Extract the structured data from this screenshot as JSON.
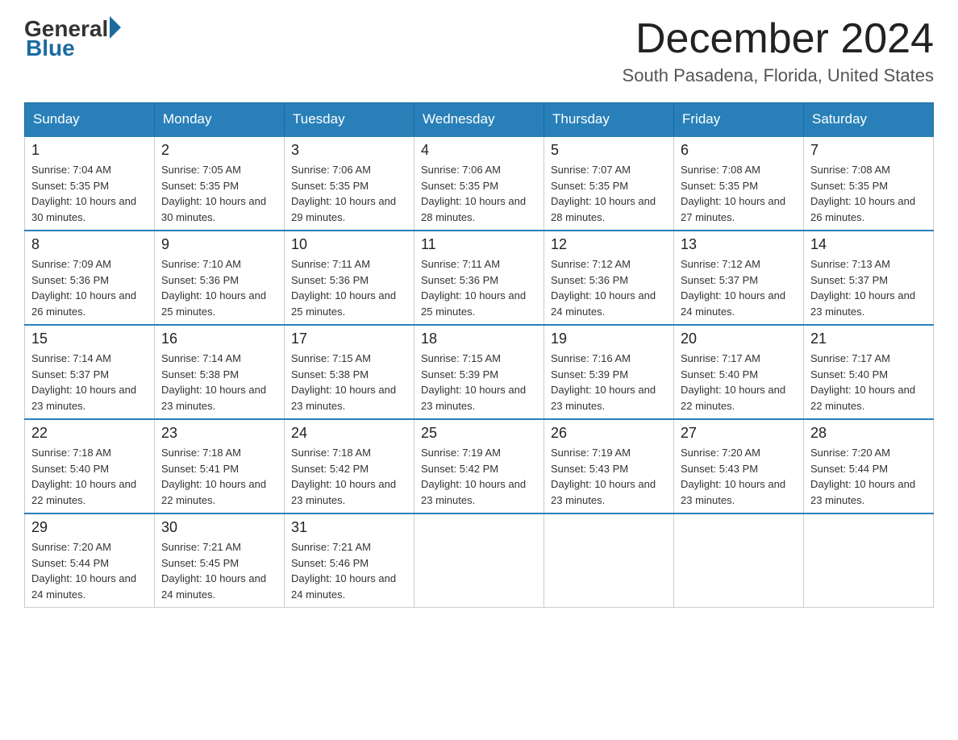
{
  "header": {
    "logo": {
      "general": "General",
      "blue": "Blue"
    },
    "title": "December 2024",
    "location": "South Pasadena, Florida, United States"
  },
  "weekdays": [
    "Sunday",
    "Monday",
    "Tuesday",
    "Wednesday",
    "Thursday",
    "Friday",
    "Saturday"
  ],
  "weeks": [
    [
      {
        "day": "1",
        "sunrise": "7:04 AM",
        "sunset": "5:35 PM",
        "daylight": "10 hours and 30 minutes."
      },
      {
        "day": "2",
        "sunrise": "7:05 AM",
        "sunset": "5:35 PM",
        "daylight": "10 hours and 30 minutes."
      },
      {
        "day": "3",
        "sunrise": "7:06 AM",
        "sunset": "5:35 PM",
        "daylight": "10 hours and 29 minutes."
      },
      {
        "day": "4",
        "sunrise": "7:06 AM",
        "sunset": "5:35 PM",
        "daylight": "10 hours and 28 minutes."
      },
      {
        "day": "5",
        "sunrise": "7:07 AM",
        "sunset": "5:35 PM",
        "daylight": "10 hours and 28 minutes."
      },
      {
        "day": "6",
        "sunrise": "7:08 AM",
        "sunset": "5:35 PM",
        "daylight": "10 hours and 27 minutes."
      },
      {
        "day": "7",
        "sunrise": "7:08 AM",
        "sunset": "5:35 PM",
        "daylight": "10 hours and 26 minutes."
      }
    ],
    [
      {
        "day": "8",
        "sunrise": "7:09 AM",
        "sunset": "5:36 PM",
        "daylight": "10 hours and 26 minutes."
      },
      {
        "day": "9",
        "sunrise": "7:10 AM",
        "sunset": "5:36 PM",
        "daylight": "10 hours and 25 minutes."
      },
      {
        "day": "10",
        "sunrise": "7:11 AM",
        "sunset": "5:36 PM",
        "daylight": "10 hours and 25 minutes."
      },
      {
        "day": "11",
        "sunrise": "7:11 AM",
        "sunset": "5:36 PM",
        "daylight": "10 hours and 25 minutes."
      },
      {
        "day": "12",
        "sunrise": "7:12 AM",
        "sunset": "5:36 PM",
        "daylight": "10 hours and 24 minutes."
      },
      {
        "day": "13",
        "sunrise": "7:12 AM",
        "sunset": "5:37 PM",
        "daylight": "10 hours and 24 minutes."
      },
      {
        "day": "14",
        "sunrise": "7:13 AM",
        "sunset": "5:37 PM",
        "daylight": "10 hours and 23 minutes."
      }
    ],
    [
      {
        "day": "15",
        "sunrise": "7:14 AM",
        "sunset": "5:37 PM",
        "daylight": "10 hours and 23 minutes."
      },
      {
        "day": "16",
        "sunrise": "7:14 AM",
        "sunset": "5:38 PM",
        "daylight": "10 hours and 23 minutes."
      },
      {
        "day": "17",
        "sunrise": "7:15 AM",
        "sunset": "5:38 PM",
        "daylight": "10 hours and 23 minutes."
      },
      {
        "day": "18",
        "sunrise": "7:15 AM",
        "sunset": "5:39 PM",
        "daylight": "10 hours and 23 minutes."
      },
      {
        "day": "19",
        "sunrise": "7:16 AM",
        "sunset": "5:39 PM",
        "daylight": "10 hours and 23 minutes."
      },
      {
        "day": "20",
        "sunrise": "7:17 AM",
        "sunset": "5:40 PM",
        "daylight": "10 hours and 22 minutes."
      },
      {
        "day": "21",
        "sunrise": "7:17 AM",
        "sunset": "5:40 PM",
        "daylight": "10 hours and 22 minutes."
      }
    ],
    [
      {
        "day": "22",
        "sunrise": "7:18 AM",
        "sunset": "5:40 PM",
        "daylight": "10 hours and 22 minutes."
      },
      {
        "day": "23",
        "sunrise": "7:18 AM",
        "sunset": "5:41 PM",
        "daylight": "10 hours and 22 minutes."
      },
      {
        "day": "24",
        "sunrise": "7:18 AM",
        "sunset": "5:42 PM",
        "daylight": "10 hours and 23 minutes."
      },
      {
        "day": "25",
        "sunrise": "7:19 AM",
        "sunset": "5:42 PM",
        "daylight": "10 hours and 23 minutes."
      },
      {
        "day": "26",
        "sunrise": "7:19 AM",
        "sunset": "5:43 PM",
        "daylight": "10 hours and 23 minutes."
      },
      {
        "day": "27",
        "sunrise": "7:20 AM",
        "sunset": "5:43 PM",
        "daylight": "10 hours and 23 minutes."
      },
      {
        "day": "28",
        "sunrise": "7:20 AM",
        "sunset": "5:44 PM",
        "daylight": "10 hours and 23 minutes."
      }
    ],
    [
      {
        "day": "29",
        "sunrise": "7:20 AM",
        "sunset": "5:44 PM",
        "daylight": "10 hours and 24 minutes."
      },
      {
        "day": "30",
        "sunrise": "7:21 AM",
        "sunset": "5:45 PM",
        "daylight": "10 hours and 24 minutes."
      },
      {
        "day": "31",
        "sunrise": "7:21 AM",
        "sunset": "5:46 PM",
        "daylight": "10 hours and 24 minutes."
      },
      null,
      null,
      null,
      null
    ]
  ]
}
